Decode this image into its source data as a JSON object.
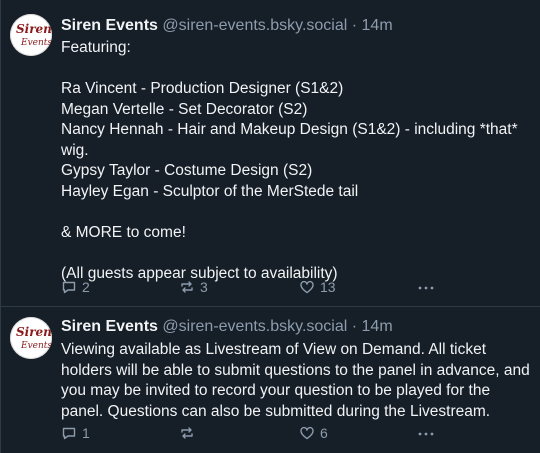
{
  "posts": [
    {
      "author_name": "Siren Events",
      "handle": "@siren-events.bsky.social",
      "separator": "·",
      "time": "14m",
      "avatar_text": [
        "Siren",
        "Events"
      ],
      "text": "Featuring:\n\nRa Vincent - Production Designer (S1&2)\nMegan Vertelle - Set Decorator (S2)\nNancy Hennah - Hair and Makeup Design (S1&2) - including *that* wig.\nGypsy Taylor - Costume Design (S2)\nHayley Egan - Sculptor of the MerStede tail\n\n& MORE to come!\n\n(All guests appear subject to availability)",
      "replies": "2",
      "reposts": "3",
      "likes": "13"
    },
    {
      "author_name": "Siren Events",
      "handle": "@siren-events.bsky.social",
      "separator": "·",
      "time": "14m",
      "avatar_text": [
        "Siren",
        "Events"
      ],
      "text": "Viewing available as Livestream of View on Demand. All ticket holders will be able to submit questions to the panel in advance, and you may be invited to record your question to be played for the panel. Questions can also be submitted during the Livestream.",
      "replies": "1",
      "reposts": "",
      "likes": "6"
    }
  ],
  "icons": {
    "reply": "speech-bubble-icon",
    "repost": "repost-arrows-icon",
    "like": "heart-outline-icon",
    "more": "ellipsis-icon"
  },
  "colors": {
    "background": "#161e27",
    "text": "#f1f3f5",
    "muted": "#8d9cad",
    "avatar_logo": "#8b1a1a"
  }
}
